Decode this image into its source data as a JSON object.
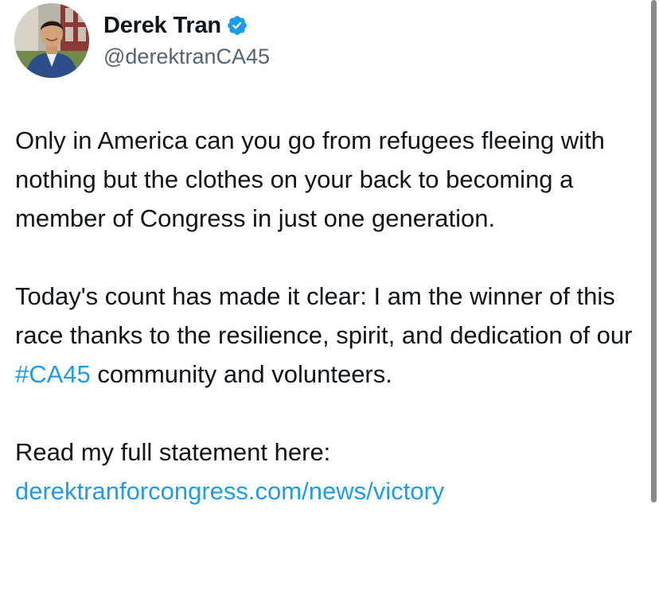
{
  "author": {
    "display_name": "Derek Tran",
    "handle": "@derektranCA45",
    "verified": true,
    "verified_icon": "verified-badge-icon",
    "verified_color": "#1d9bf0"
  },
  "tweet": {
    "paragraph_1": "Only in America can you go from refugees fleeing with nothing but the clothes on your back to becoming a member of Congress in just one generation.",
    "paragraph_2_before": "Today's count has made it clear: I am the winner of this race thanks to the resilience, spirit, and dedication of our ",
    "paragraph_2_hashtag": "#CA45",
    "paragraph_2_after": " community and volunteers.",
    "paragraph_3": "Read my full statement here:",
    "link": "derektranforcongress.com/news/victory"
  },
  "colors": {
    "text": "#0f1419",
    "secondary_text": "#536471",
    "link": "#1d9bf0",
    "background": "#ffffff"
  }
}
